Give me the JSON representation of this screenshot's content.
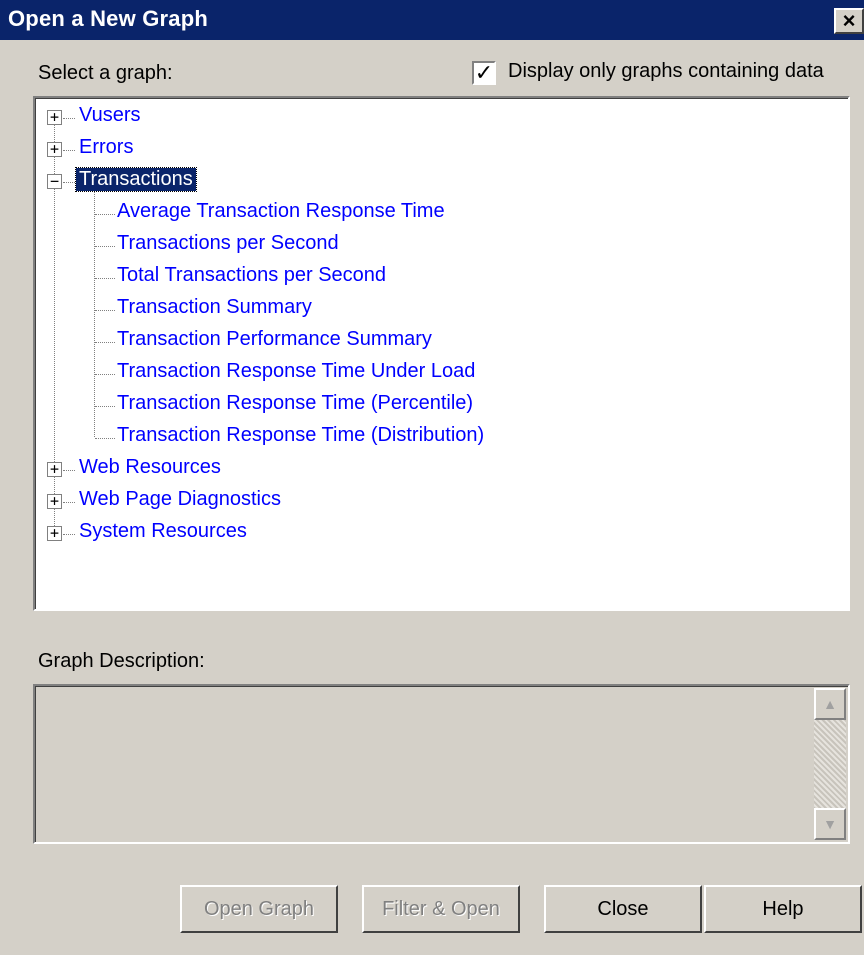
{
  "window": {
    "title": "Open a New Graph",
    "close_glyph": "×"
  },
  "select_label": "Select a graph:",
  "filter_checkbox": {
    "label": "Display only graphs containing data",
    "checked": true,
    "check_glyph": "✓"
  },
  "tree": {
    "groups": [
      {
        "label": "Vusers",
        "expander": "+"
      },
      {
        "label": "Errors",
        "expander": "+"
      },
      {
        "label": "Transactions",
        "expander": "−"
      },
      {
        "label": "Web Resources",
        "expander": "+"
      },
      {
        "label": "Web Page Diagnostics",
        "expander": "+"
      },
      {
        "label": "System Resources",
        "expander": "+"
      }
    ],
    "transaction_children": [
      "Average Transaction Response Time",
      "Transactions per Second",
      "Total Transactions per Second",
      "Transaction Summary",
      "Transaction Performance Summary",
      "Transaction Response Time Under Load",
      "Transaction Response Time (Percentile)",
      "Transaction Response Time (Distribution)"
    ]
  },
  "description_label": "Graph Description:",
  "scroll": {
    "up_glyph": "▲",
    "down_glyph": "▼"
  },
  "buttons": {
    "open_graph": "Open Graph",
    "filter_open": "Filter & Open",
    "close": "Close",
    "help": "Help"
  },
  "colors": {
    "titlebar": "#0a246a",
    "link": "#0000ff",
    "face": "#d4d0c8"
  }
}
